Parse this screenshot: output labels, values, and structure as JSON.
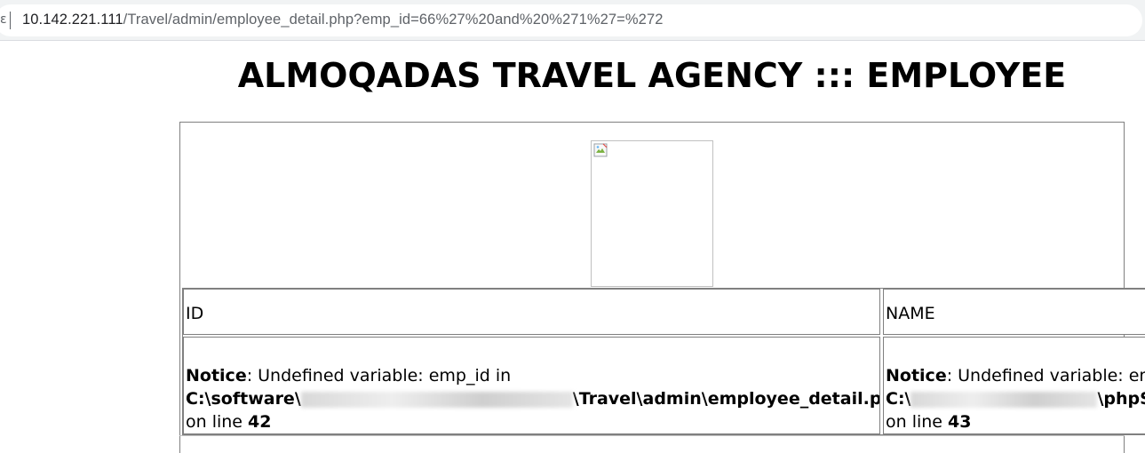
{
  "browser": {
    "url_host": "10.142.221.111",
    "url_path": "/Travel/admin/employee_detail.php?emp_id=66%27%20and%20%271%27=%272",
    "security_icon": "not-secure-icon"
  },
  "page": {
    "title": "ALMOQADAS TRAVEL AGENCY ::: EMPLOYEE",
    "photo_icon": "broken-image-icon"
  },
  "table": {
    "headers": [
      "ID",
      "NAME"
    ],
    "rows": [
      {
        "id_notice_label": "Notice",
        "id_notice_text": ": Undefined variable: emp_id in",
        "id_path_visible_start": "C:\\software\\",
        "id_path_visible_end": "\\Travel\\admin\\employee_detail.php",
        "id_line_prefix": "on line ",
        "id_line": "42",
        "name_notice_label": "Notice",
        "name_notice_text": ": Undefined variable: em",
        "name_path_visible_start": "C:\\",
        "name_path_visible_end": "\\phpS",
        "name_line_prefix": "on line ",
        "name_line": "43"
      }
    ]
  }
}
